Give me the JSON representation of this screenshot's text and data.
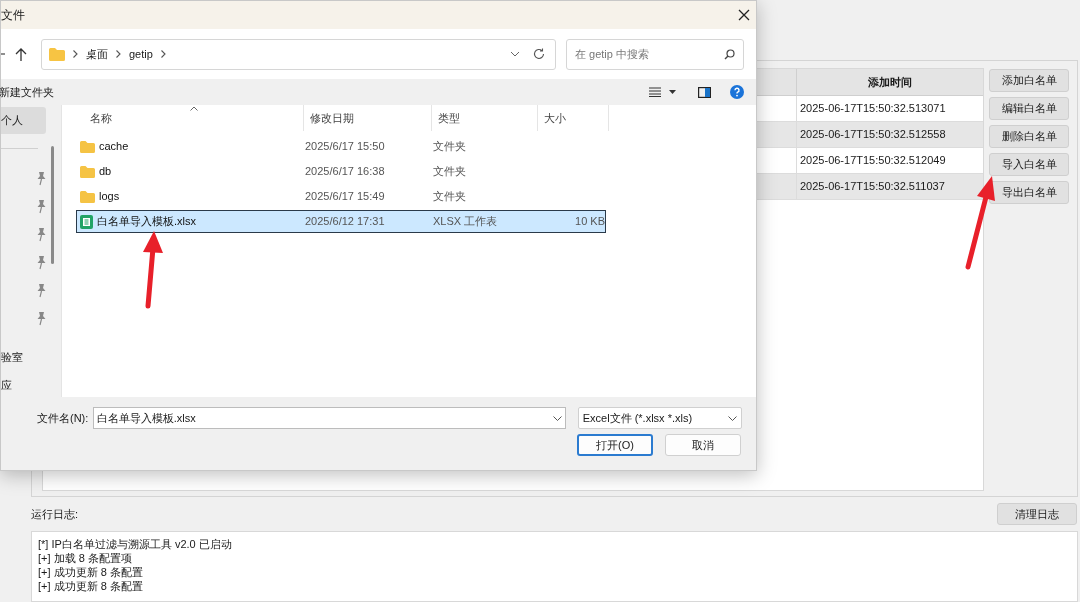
{
  "dialog": {
    "title": "文件",
    "address": {
      "segments": [
        "桌面",
        "getip"
      ]
    },
    "search": {
      "placeholder": "在 getip 中搜索"
    },
    "toolbar": {
      "new_folder": "新建文件夹"
    },
    "nav": [
      {
        "label": "个人",
        "selected": true
      },
      {
        "label": "验室",
        "selected": false
      },
      {
        "label": "应",
        "selected": false
      }
    ],
    "columns": [
      "名称",
      "修改日期",
      "类型",
      "大小"
    ],
    "files": [
      {
        "kind": "folder",
        "name": "cache",
        "modified": "2025/6/17 15:50",
        "type": "文件夹",
        "selected": false
      },
      {
        "kind": "folder",
        "name": "db",
        "modified": "2025/6/17 16:38",
        "type": "文件夹",
        "selected": false
      },
      {
        "kind": "folder",
        "name": "logs",
        "modified": "2025/6/17 15:49",
        "type": "文件夹",
        "selected": false
      },
      {
        "kind": "sheet",
        "name": "白名单导入模板.xlsx",
        "modified": "2025/6/12 17:31",
        "type": "XLSX 工作表",
        "size": "10 KB",
        "selected": true
      }
    ],
    "filename": {
      "label": "文件名(N):",
      "value": "白名单导入模板.xlsx"
    },
    "filter": "Excel文件 (*.xlsx *.xls)",
    "buttons": [
      {
        "label": "打开(O)",
        "default": true
      },
      {
        "label": "取消",
        "default": false
      }
    ]
  },
  "table": {
    "columns": [
      "添加时间"
    ],
    "rows": [
      {
        "added": "2025-06-17T15:50:32.513071"
      },
      {
        "added": "2025-06-17T15:50:32.512558"
      },
      {
        "added": "2025-06-17T15:50:32.512049"
      },
      {
        "added": "2025-06-17T15:50:32.511037"
      }
    ]
  },
  "buttons": [
    "添加白名单",
    "编辑白名单",
    "删除白名单",
    "导入白名单",
    "导出白名单"
  ],
  "log": {
    "label": "运行日志:",
    "clear_button": "清理日志",
    "lines": [
      "[*] IP白名单过滤与溯源工具 v2.0 已启动",
      "[+] 加载 8 条配置项",
      "[+] 成功更新 8 条配置",
      "[+] 成功更新 8 条配置"
    ]
  }
}
